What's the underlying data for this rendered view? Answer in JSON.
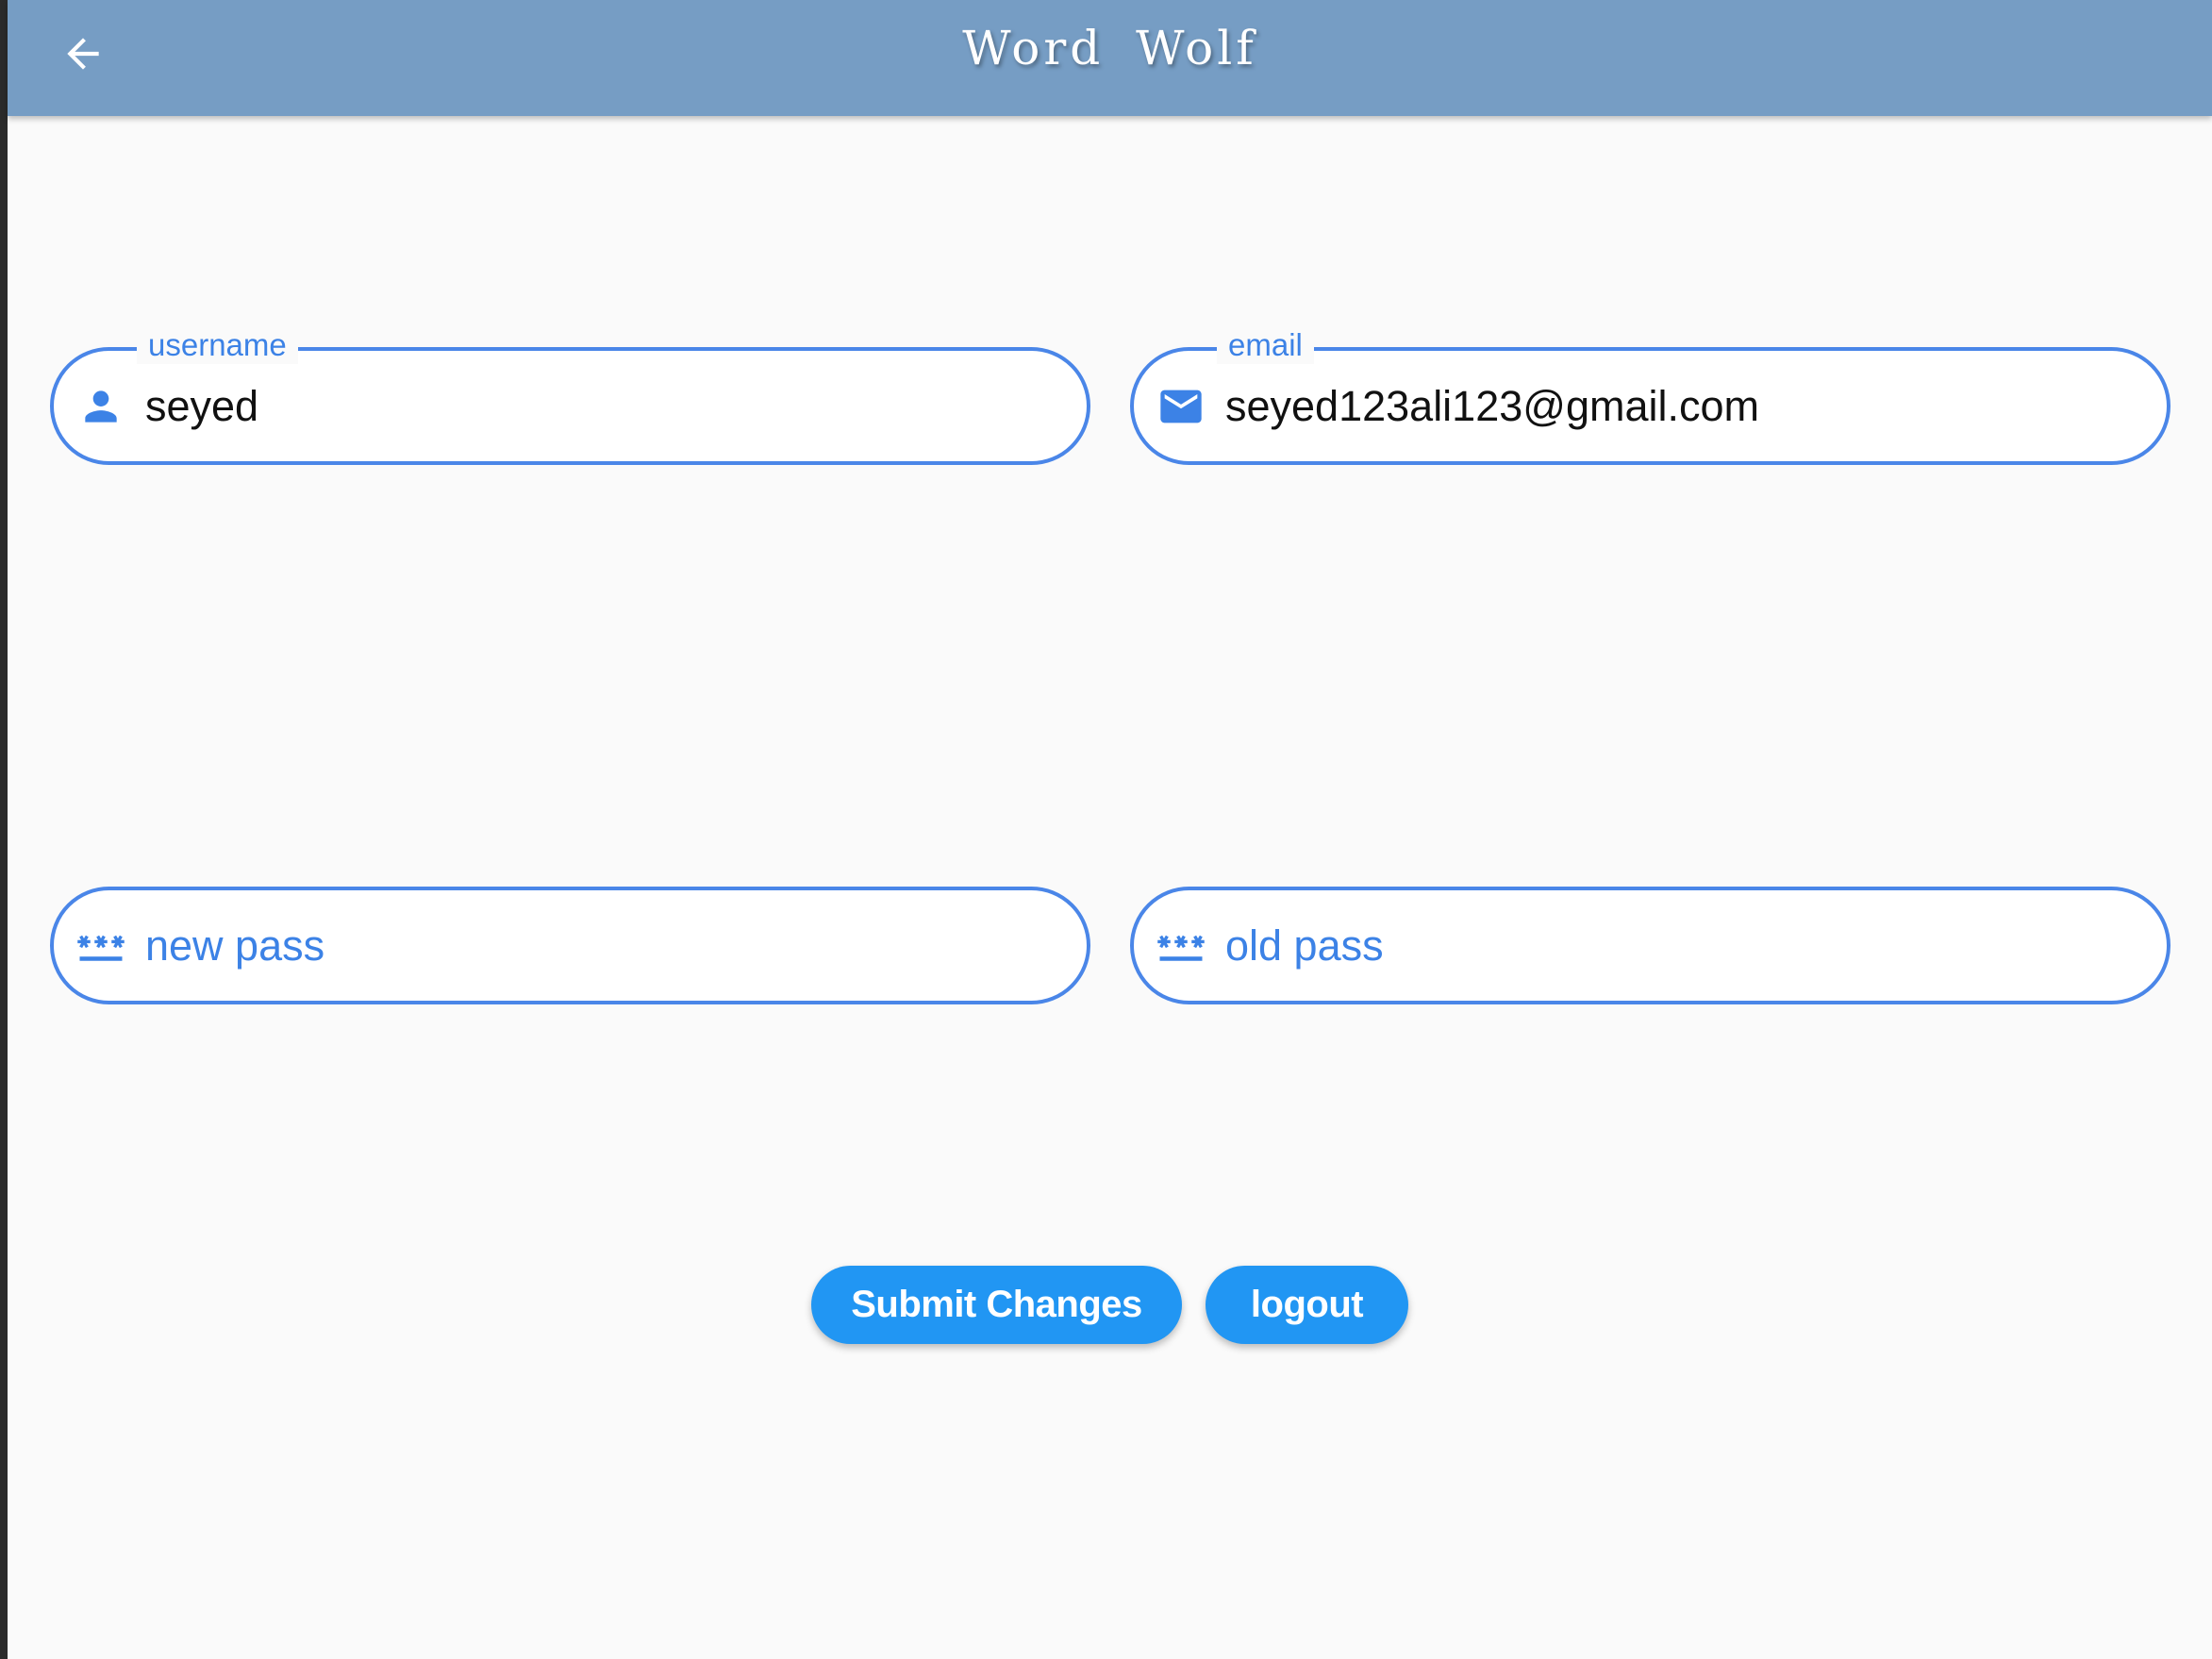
{
  "app_bar": {
    "title": "Word  Wolf",
    "back_icon": "arrow-left-icon",
    "background": "#769dc4"
  },
  "form": {
    "username": {
      "label": "username",
      "value": "seyed",
      "icon": "person-icon"
    },
    "email": {
      "label": "email",
      "value": "seyed123ali123@gmail.com",
      "icon": "mail-icon"
    },
    "new_pass": {
      "hint": "new pass",
      "icon": "password-icon"
    },
    "old_pass": {
      "hint": "old pass",
      "icon": "password-icon"
    },
    "accent": "#4a86e8"
  },
  "actions": {
    "submit_label": "Submit Changes",
    "logout_label": "logout",
    "button_color": "#2196f3"
  }
}
